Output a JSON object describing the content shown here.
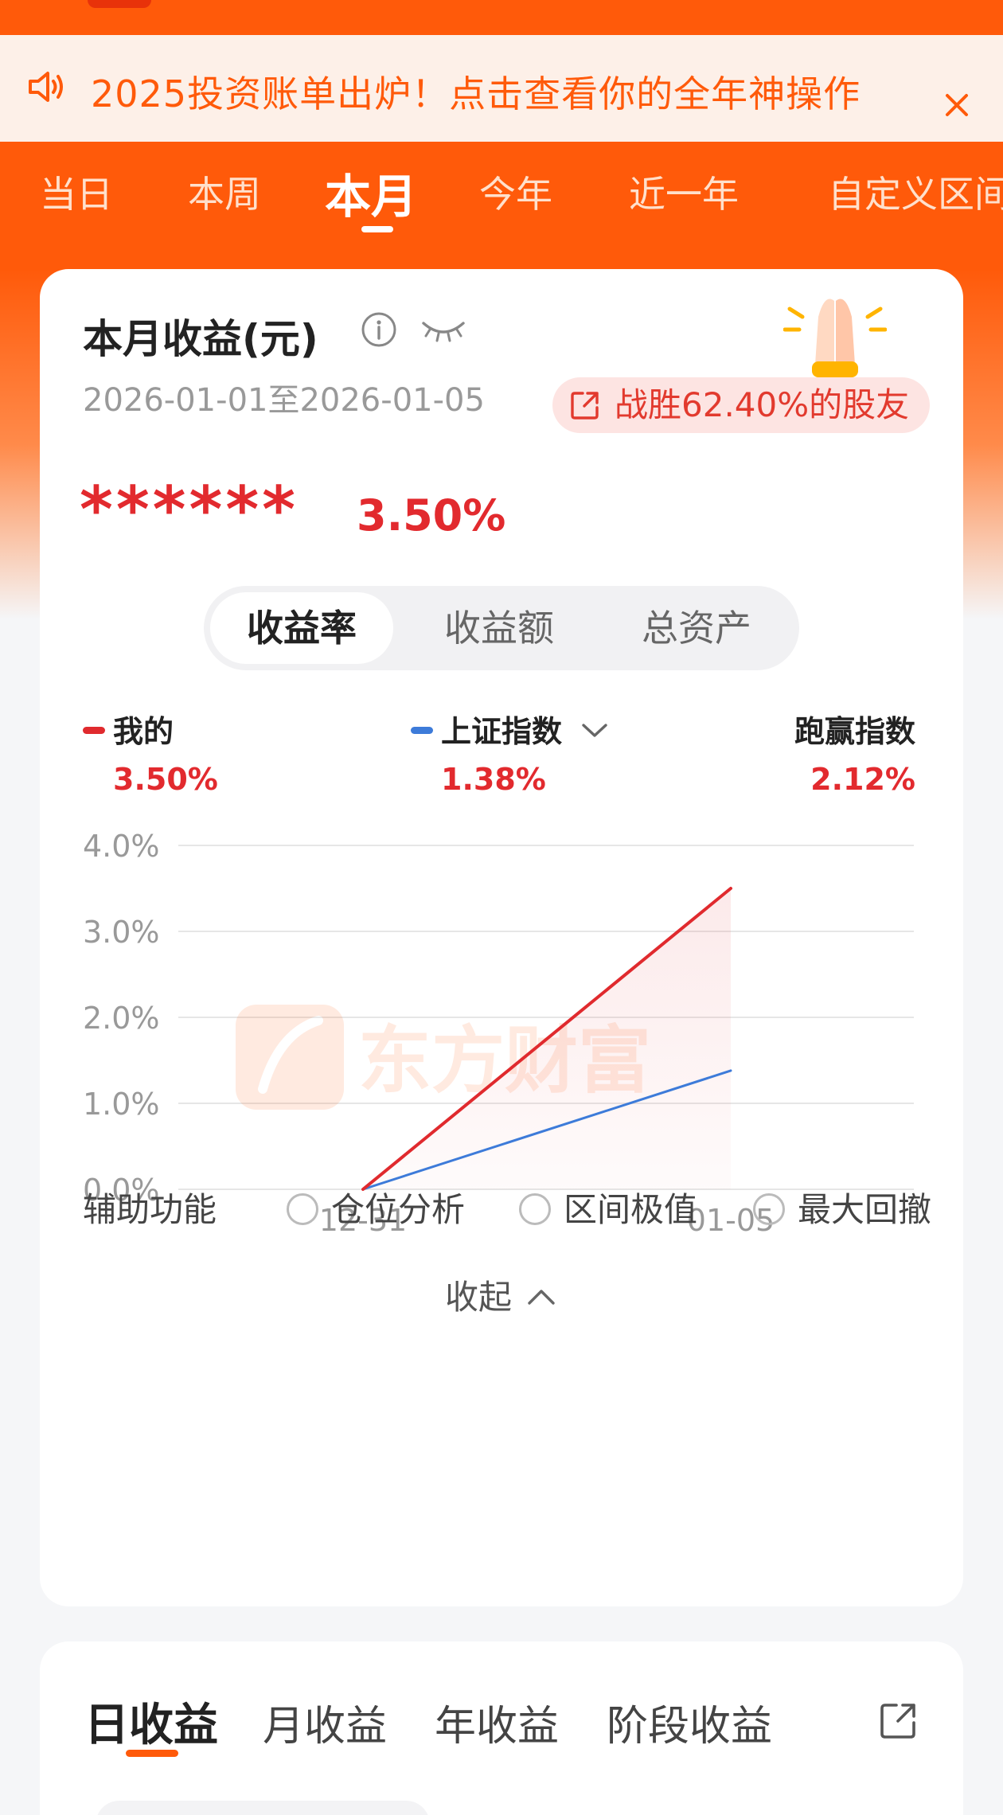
{
  "notice": {
    "text": "2025投资账单出炉！点击查看你的全年神操作"
  },
  "period_tabs": [
    {
      "label": "当日",
      "active": false
    },
    {
      "label": "本周",
      "active": false
    },
    {
      "label": "本月",
      "active": true
    },
    {
      "label": "今年",
      "active": false
    },
    {
      "label": "近一年",
      "active": false
    },
    {
      "label": "自定义区间",
      "active": false
    }
  ],
  "summary": {
    "title": "本月收益(元)",
    "date_range": "2026-01-01至2026-01-05",
    "beat_badge": "战胜62.40%的股友",
    "hidden_amount": "******",
    "return_pct": "3.50%"
  },
  "segments": [
    {
      "label": "收益率",
      "active": true
    },
    {
      "label": "收益额",
      "active": false
    },
    {
      "label": "总资产",
      "active": false
    }
  ],
  "legend": {
    "mine": {
      "name": "我的",
      "value": "3.50%"
    },
    "index": {
      "name": "上证指数",
      "value": "1.38%"
    },
    "outperform": {
      "name": "跑赢指数",
      "value": "2.12%"
    }
  },
  "chart_data": {
    "type": "line",
    "x": [
      "12-31",
      "01-05"
    ],
    "series": [
      {
        "name": "我的",
        "values": [
          0.0,
          3.5
        ],
        "color": "#e02a2e"
      },
      {
        "name": "上证指数",
        "values": [
          0.0,
          1.38
        ],
        "color": "#3d7bd9"
      }
    ],
    "y_ticks": [
      "4.0%",
      "3.0%",
      "2.0%",
      "1.0%",
      "0.0%"
    ],
    "ylim": [
      0,
      4
    ],
    "grid": true,
    "watermark": "东方财富"
  },
  "aux": {
    "label": "辅助功能",
    "options": [
      "仓位分析",
      "区间极值",
      "最大回撤"
    ]
  },
  "collapse_label": "收起",
  "profit_tabs": [
    {
      "label": "日收益",
      "active": true
    },
    {
      "label": "月收益",
      "active": false
    },
    {
      "label": "年收益",
      "active": false
    },
    {
      "label": "阶段收益",
      "active": false
    }
  ],
  "colors": {
    "brand": "#ff5a0a",
    "red": "#e22a2e",
    "blue": "#3d7bd9"
  }
}
